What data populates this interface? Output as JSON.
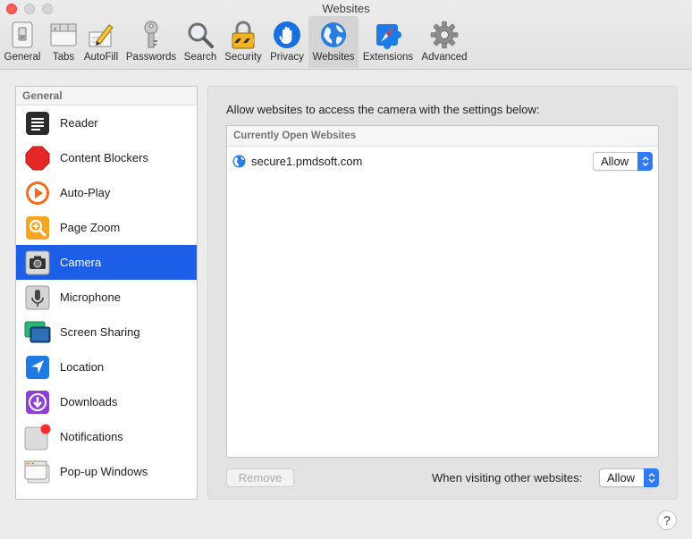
{
  "window": {
    "title": "Websites"
  },
  "toolbar": {
    "items": [
      {
        "label": "General",
        "icon": "switch-icon"
      },
      {
        "label": "Tabs",
        "icon": "tabs-icon"
      },
      {
        "label": "AutoFill",
        "icon": "pencil-form-icon"
      },
      {
        "label": "Passwords",
        "icon": "key-icon"
      },
      {
        "label": "Search",
        "icon": "magnifier-icon"
      },
      {
        "label": "Security",
        "icon": "padlock-icon"
      },
      {
        "label": "Privacy",
        "icon": "hand-icon"
      },
      {
        "label": "Websites",
        "icon": "globe-icon"
      },
      {
        "label": "Extensions",
        "icon": "puzzle-compass-icon"
      },
      {
        "label": "Advanced",
        "icon": "gear-icon"
      }
    ],
    "active": "Websites"
  },
  "sidebar": {
    "header": "General",
    "items": [
      {
        "label": "Reader",
        "icon": "reader-icon"
      },
      {
        "label": "Content Blockers",
        "icon": "stop-sign-icon"
      },
      {
        "label": "Auto-Play",
        "icon": "play-icon"
      },
      {
        "label": "Page Zoom",
        "icon": "zoom-icon"
      },
      {
        "label": "Camera",
        "icon": "camera-icon"
      },
      {
        "label": "Microphone",
        "icon": "microphone-icon"
      },
      {
        "label": "Screen Sharing",
        "icon": "screen-sharing-icon"
      },
      {
        "label": "Location",
        "icon": "location-arrow-icon"
      },
      {
        "label": "Downloads",
        "icon": "download-icon"
      },
      {
        "label": "Notifications",
        "icon": "notification-badge-icon"
      },
      {
        "label": "Pop-up Windows",
        "icon": "popup-window-icon"
      }
    ],
    "selected": "Camera"
  },
  "main": {
    "description": "Allow websites to access the camera with the settings below:",
    "table_header": "Currently Open Websites",
    "sites": [
      {
        "name": "secure1.pmdsoft.com",
        "setting": "Allow"
      }
    ],
    "remove_label": "Remove",
    "other_label": "When visiting other websites:",
    "other_setting": "Allow"
  },
  "help": {
    "label": "?"
  },
  "colors": {
    "selection": "#1d5ee6",
    "popup_accent": "#2f7bf5",
    "close_button": "#fe5f57"
  }
}
